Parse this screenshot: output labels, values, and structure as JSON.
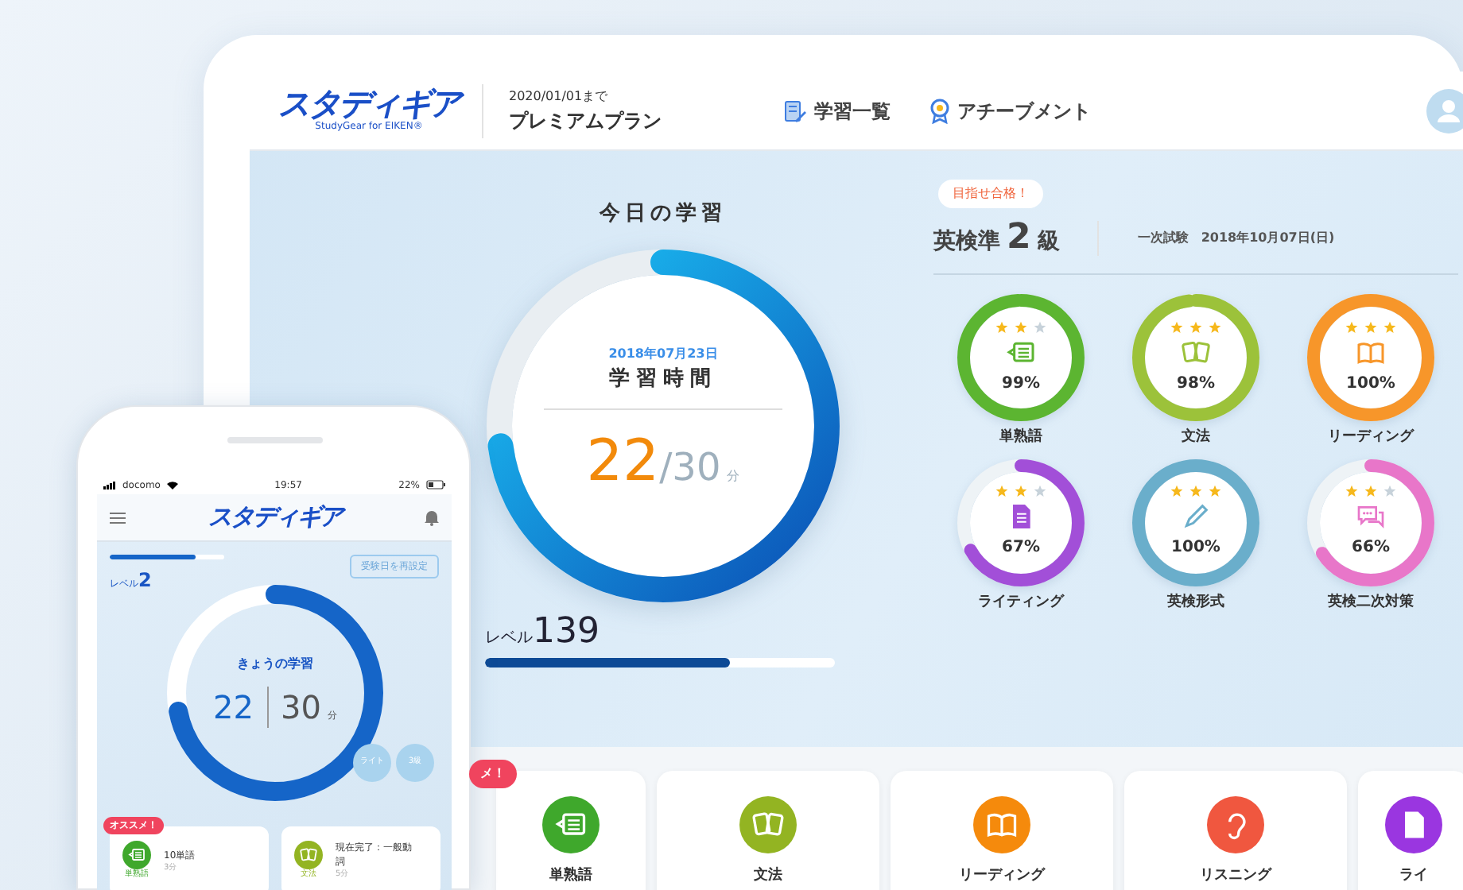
{
  "tablet": {
    "header": {
      "logo": "スタディギア",
      "logo_sub": "StudyGear for EIKEN®",
      "plan_until": "2020/01/01まで",
      "plan_name": "プレミアムプラン",
      "nav": [
        {
          "label": "学習一覧",
          "kind": "list"
        },
        {
          "label": "アチーブメント",
          "kind": "medal"
        }
      ]
    },
    "today": {
      "title": "今日の学習",
      "date": "2018年07月23日",
      "label": "学習時間",
      "done": "22",
      "goal": "/30",
      "unit": "分",
      "level": 0.73
    },
    "level": {
      "label": "レベル",
      "value": "139",
      "level": 0.7
    },
    "exam": {
      "badge": "目指せ合格！",
      "grade_prefix": "英検準",
      "grade": "2",
      "grade_suffix": "級",
      "date": "一次試験　2018年10月07日(日)"
    },
    "skills": [
      {
        "name": "単熟語",
        "percent": "99%",
        "stars": 2,
        "level": 0.99,
        "color": "#5cb531",
        "kind": "vocab"
      },
      {
        "name": "文法",
        "percent": "98%",
        "stars": 3,
        "level": 0.98,
        "color": "#9cc23a",
        "kind": "grammar"
      },
      {
        "name": "リーディング",
        "percent": "100%",
        "stars": 3,
        "level": 1,
        "color": "#f7962a",
        "kind": "reading"
      },
      {
        "name": "ライティング",
        "percent": "67%",
        "stars": 2,
        "level": 0.67,
        "color": "#a24fd8",
        "kind": "writing"
      },
      {
        "name": "英検形式",
        "percent": "100%",
        "stars": 3,
        "level": 1,
        "color": "#6aaecb",
        "kind": "format"
      },
      {
        "name": "英検二次対策",
        "percent": "66%",
        "stars": 2,
        "level": 0.66,
        "color": "#e876c9",
        "kind": "speaking"
      }
    ],
    "menu": {
      "badge": "メ！",
      "cards": [
        {
          "label": "単熟語",
          "kind": "vocab",
          "color": "#3fa82c"
        },
        {
          "label": "文法",
          "kind": "grammar",
          "color": "#93b422"
        },
        {
          "label": "リーディング",
          "kind": "reading",
          "color": "#f58a0c"
        },
        {
          "label": "リスニング",
          "kind": "listening",
          "color": "#f0573f"
        },
        {
          "label": "ライ",
          "kind": "writing",
          "color": "#9a36e0"
        }
      ]
    }
  },
  "phone": {
    "status": {
      "carrier": "docomo",
      "time": "19:57",
      "battery": "22%"
    },
    "logo": "スタディギア",
    "level": {
      "label": "レベル",
      "value": "2",
      "level": 0.75
    },
    "reset_button": "受験日を再設定",
    "today": {
      "title": "きょうの学習",
      "done": "22",
      "goal": "30",
      "unit": "分",
      "level": 0.72
    },
    "chips": [
      "ライト",
      "3級"
    ],
    "recommend_badge": "オススメ！",
    "cards": [
      {
        "icon_label": "単熟語",
        "kind": "vocab",
        "color": "#3fa82c",
        "title": "10単語",
        "time": "3分"
      },
      {
        "icon_label": "文法",
        "kind": "grammar",
        "color": "#93b422",
        "title": "現在完了：一般動詞",
        "time": "5分"
      }
    ]
  }
}
